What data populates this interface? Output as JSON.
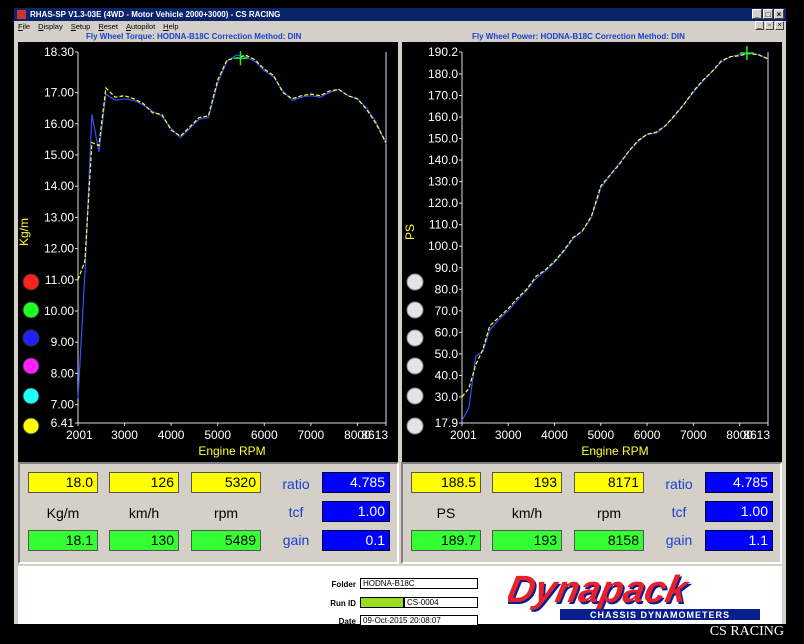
{
  "window": {
    "title": "RHAS-SP V1.3-03E  (4WD - Motor Vehicle 2000+3000)  -  CS RACING",
    "menus": [
      "File",
      "Display",
      "Setup",
      "Reset",
      "Autopilot",
      "Help"
    ]
  },
  "torque_chart": {
    "title": "Fly Wheel Torque: HODNA-B18C      Correction Method: DIN",
    "xlabel": "Engine RPM",
    "ylabel": "Kg/m",
    "xticks": [
      "2001",
      "3000",
      "4000",
      "5000",
      "6000",
      "7000",
      "8000",
      "8613"
    ],
    "yticks": [
      "18.30",
      "17.00",
      "16.00",
      "15.00",
      "14.00",
      "13.00",
      "12.00",
      "11.00",
      "10.00",
      "9.00",
      "8.00",
      "7.00",
      "6.41"
    ],
    "indicator_colors": [
      "#ff2020",
      "#20ff20",
      "#2020ff",
      "#ff20ff",
      "#20ffff",
      "#ffff00"
    ]
  },
  "power_chart": {
    "title": "Fly Wheel Power: HODNA-B18C      Correction Method: DIN",
    "xlabel": "Engine RPM",
    "ylabel": "PS",
    "xticks": [
      "2001",
      "3000",
      "4000",
      "5000",
      "6000",
      "7000",
      "8000",
      "8613"
    ],
    "yticks": [
      "190.2",
      "180.0",
      "170.0",
      "160.0",
      "150.0",
      "140.0",
      "130.0",
      "120.0",
      "110.0",
      "100.0",
      "90.0",
      "80.0",
      "70.0",
      "60.0",
      "50.0",
      "40.0",
      "30.0",
      "17.9"
    ]
  },
  "chart_data": [
    {
      "type": "line",
      "title": "Fly Wheel Torque: HODNA-B18C      Correction Method: DIN",
      "xlabel": "Engine RPM",
      "ylabel": "Kg/m",
      "xlim": [
        2001,
        8613
      ],
      "ylim": [
        6.41,
        18.3
      ],
      "grid": false,
      "series": [
        {
          "color": "#ffff33",
          "x": [
            2001,
            2150,
            2300,
            2450,
            2600,
            2800,
            3000,
            3200,
            3400,
            3600,
            3800,
            4000,
            4200,
            4400,
            4600,
            4800,
            5000,
            5200,
            5400,
            5600,
            5800,
            6000,
            6200,
            6400,
            6600,
            6800,
            7000,
            7200,
            7400,
            7600,
            7800,
            8000,
            8200,
            8400,
            8613
          ],
          "y": [
            11.0,
            11.6,
            15.4,
            15.3,
            17.15,
            16.85,
            16.9,
            16.8,
            16.65,
            16.35,
            16.3,
            15.8,
            15.6,
            15.9,
            16.2,
            16.25,
            17.4,
            18.05,
            18.1,
            18.2,
            18.05,
            17.75,
            17.55,
            17.0,
            16.8,
            16.9,
            16.95,
            16.9,
            17.05,
            17.1,
            16.9,
            16.8,
            16.45,
            16.0,
            15.4
          ]
        },
        {
          "color": "#3050ff",
          "x": [
            2001,
            2150,
            2300,
            2450,
            2600,
            2800,
            3000,
            3200,
            3400,
            3600,
            3800,
            4000,
            4200,
            4400,
            4600,
            4800,
            5000,
            5200,
            5400,
            5600,
            5800,
            6000,
            6200,
            6400,
            6600,
            6800,
            7000,
            7200,
            7400,
            7600,
            7800,
            8000,
            8200,
            8400,
            8613
          ],
          "y": [
            7.2,
            11.2,
            16.3,
            15.1,
            16.95,
            16.75,
            16.8,
            16.75,
            16.6,
            16.4,
            16.25,
            15.85,
            15.55,
            15.85,
            16.15,
            16.2,
            17.3,
            18.0,
            18.2,
            18.15,
            18.0,
            17.7,
            17.5,
            17.05,
            16.75,
            16.85,
            16.9,
            16.85,
            17.0,
            17.1,
            16.9,
            16.8,
            16.5,
            16.05,
            15.35
          ]
        }
      ],
      "marker": {
        "x": 5489,
        "y": 18.1
      }
    },
    {
      "type": "line",
      "title": "Fly Wheel Power: HODNA-B18C      Correction Method: DIN",
      "xlabel": "Engine RPM",
      "ylabel": "PS",
      "xlim": [
        2001,
        8613
      ],
      "ylim": [
        17.9,
        190.2
      ],
      "grid": false,
      "series": [
        {
          "color": "#ffff33",
          "x": [
            2001,
            2150,
            2300,
            2450,
            2600,
            2800,
            3000,
            3200,
            3400,
            3600,
            3800,
            4000,
            4200,
            4400,
            4600,
            4800,
            5000,
            5200,
            5400,
            5600,
            5800,
            6000,
            6200,
            6400,
            6600,
            6800,
            7000,
            7200,
            7400,
            7600,
            7800,
            8000,
            8200,
            8400,
            8613
          ],
          "y": [
            30.0,
            34.0,
            45.0,
            52.0,
            63.0,
            67.0,
            71.0,
            76.0,
            80.0,
            86.0,
            89.0,
            93.0,
            98.0,
            104.0,
            107.0,
            114.0,
            128.0,
            133.0,
            138.0,
            144.0,
            149.0,
            152.0,
            153.0,
            156.0,
            161.0,
            166.0,
            172.0,
            177.0,
            181.0,
            186.0,
            188.0,
            188.5,
            189.5,
            189.0,
            187.0
          ]
        },
        {
          "color": "#3050ff",
          "x": [
            2001,
            2150,
            2300,
            2450,
            2600,
            2800,
            3000,
            3200,
            3400,
            3600,
            3800,
            4000,
            4200,
            4400,
            4600,
            4800,
            5000,
            5200,
            5400,
            5600,
            5800,
            6000,
            6200,
            6400,
            6600,
            6800,
            7000,
            7200,
            7400,
            7600,
            7800,
            8000,
            8200,
            8400,
            8613
          ],
          "y": [
            19.0,
            25.0,
            49.0,
            51.0,
            61.0,
            66.0,
            70.0,
            75.0,
            79.5,
            85.0,
            88.5,
            92.5,
            97.5,
            103.5,
            107.0,
            113.5,
            127.0,
            133.0,
            138.5,
            144.0,
            148.5,
            152.0,
            152.5,
            156.0,
            160.5,
            166.0,
            171.5,
            176.5,
            181.0,
            185.5,
            188.0,
            189.0,
            189.5,
            189.0,
            187.0
          ]
        }
      ],
      "marker": {
        "x": 8158,
        "y": 189.7
      }
    }
  ],
  "readouts": {
    "left": {
      "row1": [
        "18.0",
        "126",
        "5320"
      ],
      "units": [
        "Kg/m",
        "km/h",
        "rpm"
      ],
      "row3": [
        "18.1",
        "130",
        "5489"
      ],
      "ratio_label": "ratio",
      "ratio": "4.785",
      "tcf_label": "tcf",
      "tcf": "1.00",
      "gain_label": "gain",
      "gain": "0.1"
    },
    "right": {
      "row1": [
        "188.5",
        "193",
        "8171"
      ],
      "units": [
        "PS",
        "km/h",
        "rpm"
      ],
      "row3": [
        "189.7",
        "193",
        "8158"
      ],
      "ratio_label": "ratio",
      "ratio": "4.785",
      "tcf_label": "tcf",
      "tcf": "1.00",
      "gain_label": "gain",
      "gain": "1.1"
    }
  },
  "footer": {
    "folder_label": "Folder",
    "folder": "HODNA-B18C",
    "runid_label": "Run ID",
    "runid": "CS-0004",
    "date_label": "Date",
    "date": "09-Oct-2015  20:08:07",
    "brand_name": "Dynapack",
    "brand_tagline": "CHASSIS      DYNAMOMETERS",
    "watermark": "CS RACING",
    "runid_color": "#99dd22"
  }
}
